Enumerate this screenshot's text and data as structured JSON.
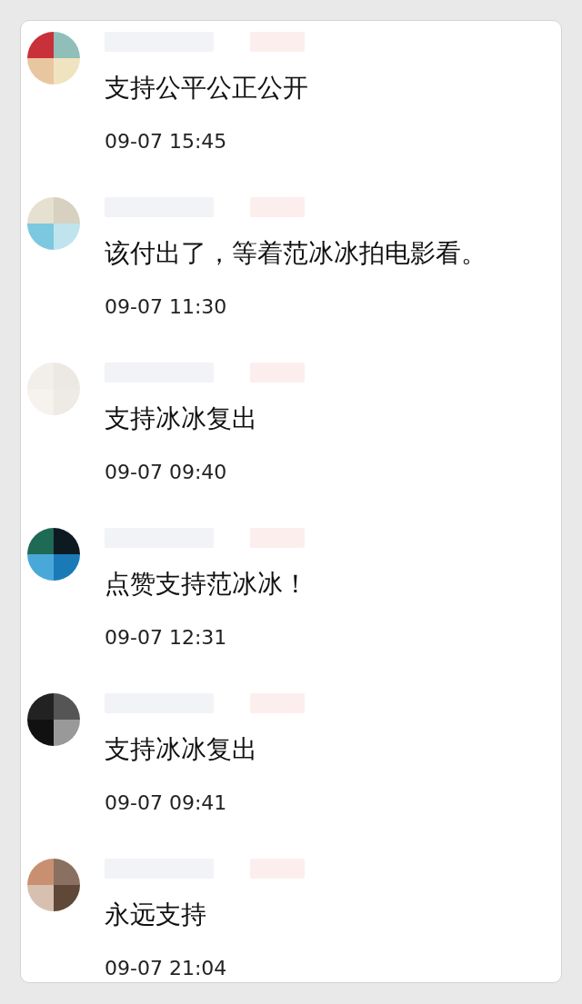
{
  "comments": [
    {
      "text": "支持公平公正公开",
      "time": "09-07 15:45"
    },
    {
      "text": "该付出了，等着范冰冰拍电影看。",
      "time": "09-07 11:30"
    },
    {
      "text": "支持冰冰复出",
      "time": "09-07 09:40"
    },
    {
      "text": "点赞支持范冰冰！",
      "time": "09-07 12:31"
    },
    {
      "text": "支持冰冰复出",
      "time": "09-07 09:41"
    },
    {
      "text": "永远支持",
      "time": "09-07 21:04"
    }
  ]
}
